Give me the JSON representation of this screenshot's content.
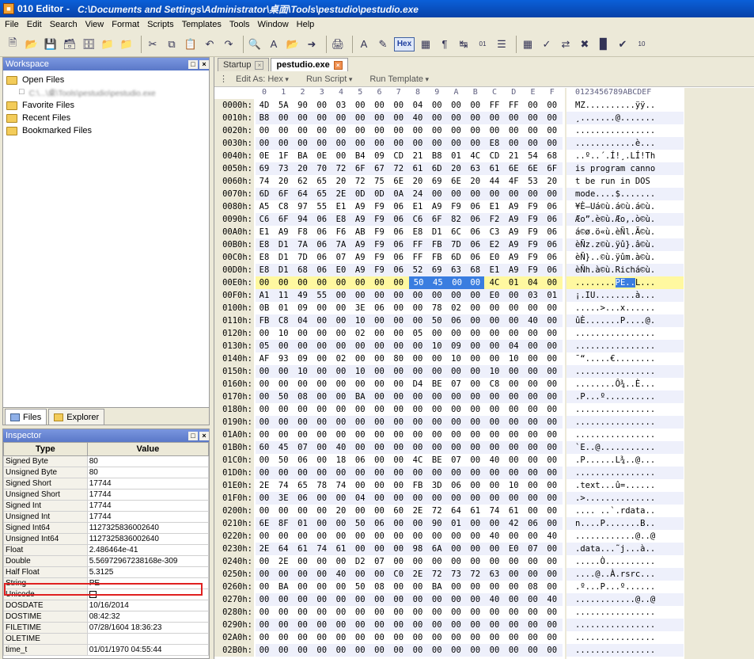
{
  "window": {
    "app_name": "010 Editor",
    "title_path": "C:\\Documents and Settings\\Administrator\\桌面\\Tools\\pestudio\\pestudio.exe"
  },
  "menu": [
    "File",
    "Edit",
    "Search",
    "View",
    "Format",
    "Scripts",
    "Templates",
    "Tools",
    "Window",
    "Help"
  ],
  "toolbar": {
    "hex_label": "Hex"
  },
  "workspace": {
    "title": "Workspace",
    "items": [
      {
        "label": "Open Files"
      },
      {
        "label": "Favorite Files"
      },
      {
        "label": "Recent Files"
      },
      {
        "label": "Bookmarked Files"
      }
    ],
    "open_file_prefix": "C:\\...\\桌\\Tools\\pestudio\\pestudio.exe",
    "tabs": [
      "Files",
      "Explorer"
    ]
  },
  "inspector": {
    "title": "Inspector",
    "col_type": "Type",
    "col_value": "Value",
    "rows": [
      {
        "type": "Signed Byte",
        "value": "80"
      },
      {
        "type": "Unsigned Byte",
        "value": "80"
      },
      {
        "type": "Signed Short",
        "value": "17744"
      },
      {
        "type": "Unsigned Short",
        "value": "17744"
      },
      {
        "type": "Signed Int",
        "value": "17744"
      },
      {
        "type": "Unsigned Int",
        "value": "17744"
      },
      {
        "type": "Signed Int64",
        "value": "1127325836002640"
      },
      {
        "type": "Unsigned Int64",
        "value": "1127325836002640"
      },
      {
        "type": "Float",
        "value": "2.486464e-41"
      },
      {
        "type": "Double",
        "value": "5.56972967238168e-309"
      },
      {
        "type": "Half Float",
        "value": "5.3125"
      },
      {
        "type": "String",
        "value": "PE"
      },
      {
        "type": "Unicode",
        "value": ""
      },
      {
        "type": "DOSDATE",
        "value": "10/16/2014"
      },
      {
        "type": "DOSTIME",
        "value": "08:42:32"
      },
      {
        "type": "FILETIME",
        "value": "07/28/1604 18:36:23"
      },
      {
        "type": "OLETIME",
        "value": ""
      },
      {
        "type": "time_t",
        "value": "01/01/1970 04:55:44"
      }
    ]
  },
  "editor": {
    "tabs": [
      {
        "label": "Startup"
      },
      {
        "label": "pestudio.exe"
      }
    ],
    "edit_as": "Edit As: Hex",
    "run_script": "Run Script",
    "run_template": "Run Template",
    "col_header": [
      "0",
      "1",
      "2",
      "3",
      "4",
      "5",
      "6",
      "7",
      "8",
      "9",
      "A",
      "B",
      "C",
      "D",
      "E",
      "F"
    ],
    "ascii_header": "0123456789ABCDEF",
    "highlight_row": "00E0h:",
    "selected_bytes": [
      8,
      9,
      10,
      11
    ],
    "rows": [
      {
        "addr": "0000h:",
        "hex": "4D 5A 90 00 03 00 00 00 04 00 00 00 FF FF 00 00",
        "ascii": "MZ..........ÿÿ.."
      },
      {
        "addr": "0010h:",
        "hex": "B8 00 00 00 00 00 00 00 40 00 00 00 00 00 00 00",
        "ascii": "¸.......@......."
      },
      {
        "addr": "0020h:",
        "hex": "00 00 00 00 00 00 00 00 00 00 00 00 00 00 00 00",
        "ascii": "................"
      },
      {
        "addr": "0030h:",
        "hex": "00 00 00 00 00 00 00 00 00 00 00 00 E8 00 00 00",
        "ascii": "............è..."
      },
      {
        "addr": "0040h:",
        "hex": "0E 1F BA 0E 00 B4 09 CD 21 B8 01 4C CD 21 54 68",
        "ascii": "..º..´.Í!¸.LÍ!Th"
      },
      {
        "addr": "0050h:",
        "hex": "69 73 20 70 72 6F 67 72 61 6D 20 63 61 6E 6E 6F",
        "ascii": "is program canno"
      },
      {
        "addr": "0060h:",
        "hex": "74 20 62 65 20 72 75 6E 20 69 6E 20 44 4F 53 20",
        "ascii": "t be run in DOS "
      },
      {
        "addr": "0070h:",
        "hex": "6D 6F 64 65 2E 0D 0D 0A 24 00 00 00 00 00 00 00",
        "ascii": "mode....$......."
      },
      {
        "addr": "0080h:",
        "hex": "A5 C8 97 55 E1 A9 F9 06 E1 A9 F9 06 E1 A9 F9 06",
        "ascii": "¥È—Uá©ù.á©ù.á©ù."
      },
      {
        "addr": "0090h:",
        "hex": "C6 6F 94 06 E8 A9 F9 06 C6 6F 82 06 F2 A9 F9 06",
        "ascii": "Æo”.è©ù.Æo,.ò©ù."
      },
      {
        "addr": "00A0h:",
        "hex": "E1 A9 F8 06 F6 AB F9 06 E8 D1 6C 06 C3 A9 F9 06",
        "ascii": "á©ø.ö«ù.èÑl.Ã©ù."
      },
      {
        "addr": "00B0h:",
        "hex": "E8 D1 7A 06 7A A9 F9 06 FF FB 7D 06 E2 A9 F9 06",
        "ascii": "èÑz.z©ù.ÿû}.â©ù."
      },
      {
        "addr": "00C0h:",
        "hex": "E8 D1 7D 06 07 A9 F9 06 FF FB 6D 06 E0 A9 F9 06",
        "ascii": "èÑ}..©ù.ÿûm.à©ù."
      },
      {
        "addr": "00D0h:",
        "hex": "E8 D1 68 06 E0 A9 F9 06 52 69 63 68 E1 A9 F9 06",
        "ascii": "èÑh.à©ù.Richá©ù."
      },
      {
        "addr": "00E0h:",
        "hex": "00 00 00 00 00 00 00 00 50 45 00 00 4C 01 04 00",
        "ascii": "........PE..L..."
      },
      {
        "addr": "00F0h:",
        "hex": "A1 11 49 55 00 00 00 00 00 00 00 00 E0 00 03 01",
        "ascii": "¡.IU........à..."
      },
      {
        "addr": "0100h:",
        "hex": "0B 01 09 00 00 3E 06 00 00 78 02 00 00 00 00 00",
        "ascii": ".....>...x......"
      },
      {
        "addr": "0110h:",
        "hex": "FB C8 04 00 00 10 00 00 00 50 06 00 00 00 40 00",
        "ascii": "ûÈ.......P....@."
      },
      {
        "addr": "0120h:",
        "hex": "00 10 00 00 00 02 00 00 05 00 00 00 00 00 00 00",
        "ascii": "................"
      },
      {
        "addr": "0130h:",
        "hex": "05 00 00 00 00 00 00 00 00 10 09 00 00 04 00 00",
        "ascii": "................"
      },
      {
        "addr": "0140h:",
        "hex": "AF 93 09 00 02 00 00 80 00 00 10 00 00 10 00 00",
        "ascii": "¯“.....€........"
      },
      {
        "addr": "0150h:",
        "hex": "00 00 10 00 00 10 00 00 00 00 00 00 10 00 00 00",
        "ascii": "................"
      },
      {
        "addr": "0160h:",
        "hex": "00 00 00 00 00 00 00 00 D4 BE 07 00 C8 00 00 00",
        "ascii": "........Ô¾..È..."
      },
      {
        "addr": "0170h:",
        "hex": "00 50 08 00 00 BA 00 00 00 00 00 00 00 00 00 00",
        "ascii": ".P...º.........."
      },
      {
        "addr": "0180h:",
        "hex": "00 00 00 00 00 00 00 00 00 00 00 00 00 00 00 00",
        "ascii": "................"
      },
      {
        "addr": "0190h:",
        "hex": "00 00 00 00 00 00 00 00 00 00 00 00 00 00 00 00",
        "ascii": "................"
      },
      {
        "addr": "01A0h:",
        "hex": "00 00 00 00 00 00 00 00 00 00 00 00 00 00 00 00",
        "ascii": "................"
      },
      {
        "addr": "01B0h:",
        "hex": "60 45 07 00 40 00 00 00 00 00 00 00 00 00 00 00",
        "ascii": "`E..@..........."
      },
      {
        "addr": "01C0h:",
        "hex": "00 50 06 00 18 06 00 00 4C BE 07 00 40 00 00 00",
        "ascii": ".P......L¾..@..."
      },
      {
        "addr": "01D0h:",
        "hex": "00 00 00 00 00 00 00 00 00 00 00 00 00 00 00 00",
        "ascii": "................"
      },
      {
        "addr": "01E0h:",
        "hex": "2E 74 65 78 74 00 00 00 FB 3D 06 00 00 10 00 00",
        "ascii": ".text...û=......"
      },
      {
        "addr": "01F0h:",
        "hex": "00 3E 06 00 00 04 00 00 00 00 00 00 00 00 00 00",
        "ascii": ".>.............."
      },
      {
        "addr": "0200h:",
        "hex": "00 00 00 00 20 00 00 60 2E 72 64 61 74 61 00 00",
        "ascii": ".... ..`.rdata.."
      },
      {
        "addr": "0210h:",
        "hex": "6E 8F 01 00 00 50 06 00 00 90 01 00 00 42 06 00",
        "ascii": "n....P.......B.."
      },
      {
        "addr": "0220h:",
        "hex": "00 00 00 00 00 00 00 00 00 00 00 00 40 00 00 40",
        "ascii": "............@..@"
      },
      {
        "addr": "0230h:",
        "hex": "2E 64 61 74 61 00 00 00 98 6A 00 00 00 E0 07 00",
        "ascii": ".data...˜j...à.."
      },
      {
        "addr": "0240h:",
        "hex": "00 2E 00 00 00 D2 07 00 00 00 00 00 00 00 00 00",
        "ascii": ".....Ò.........."
      },
      {
        "addr": "0250h:",
        "hex": "00 00 00 00 40 00 00 C0 2E 72 73 72 63 00 00 00",
        "ascii": "....@..À.rsrc..."
      },
      {
        "addr": "0260h:",
        "hex": "00 BA 00 00 00 50 08 00 00 BA 00 00 00 00 08 00",
        "ascii": ".º...P...º......"
      },
      {
        "addr": "0270h:",
        "hex": "00 00 00 00 00 00 00 00 00 00 00 00 40 00 00 40",
        "ascii": "............@..@"
      },
      {
        "addr": "0280h:",
        "hex": "00 00 00 00 00 00 00 00 00 00 00 00 00 00 00 00",
        "ascii": "................"
      },
      {
        "addr": "0290h:",
        "hex": "00 00 00 00 00 00 00 00 00 00 00 00 00 00 00 00",
        "ascii": "................"
      },
      {
        "addr": "02A0h:",
        "hex": "00 00 00 00 00 00 00 00 00 00 00 00 00 00 00 00",
        "ascii": "................"
      },
      {
        "addr": "02B0h:",
        "hex": "00 00 00 00 00 00 00 00 00 00 00 00 00 00 00 00",
        "ascii": "................"
      }
    ]
  }
}
